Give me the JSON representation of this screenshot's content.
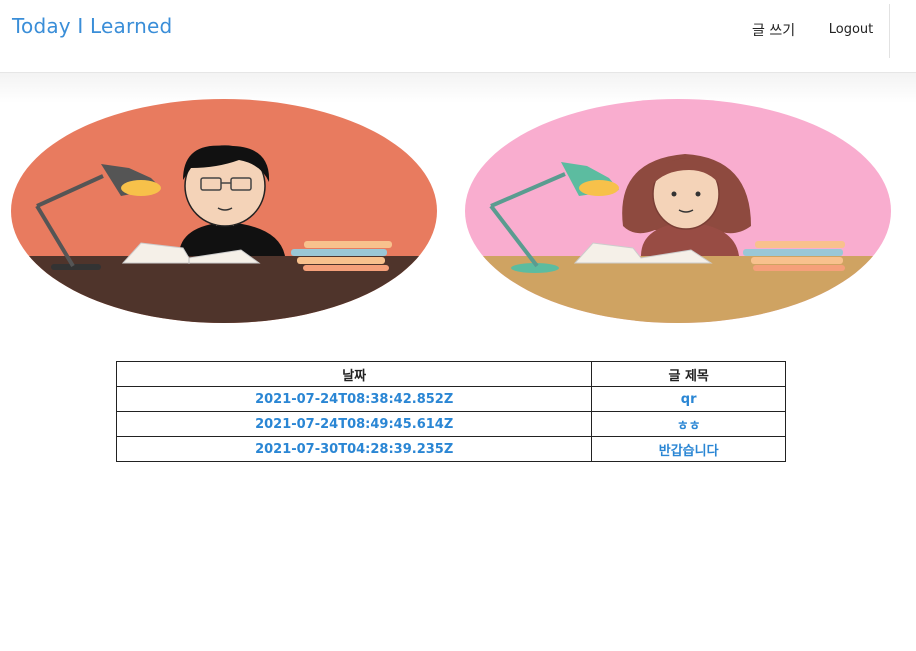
{
  "navbar": {
    "brand": "Today I Learned",
    "write_label": "글 쓰기",
    "logout_label": "Logout"
  },
  "illustrations": [
    {
      "name": "boy-studying",
      "bg_color": "#e87b5f",
      "desk_color": "#4f342b"
    },
    {
      "name": "girl-studying",
      "bg_color": "#f9adcf",
      "desk_color": "#cfa362"
    }
  ],
  "table": {
    "headers": [
      "날짜",
      "글 제목"
    ],
    "rows": [
      {
        "date": "2021-07-24T08:38:42.852Z",
        "title": "qr"
      },
      {
        "date": "2021-07-24T08:49:45.614Z",
        "title": "ㅎㅎ"
      },
      {
        "date": "2021-07-30T04:28:39.235Z",
        "title": "반갑습니다"
      }
    ]
  },
  "colors": {
    "brand": "#3a8ed8",
    "link": "#2a86d4"
  }
}
